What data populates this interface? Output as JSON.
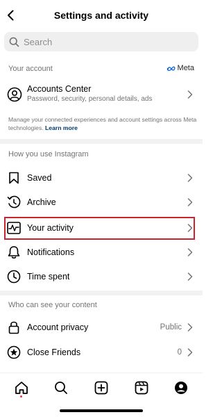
{
  "header": {
    "title": "Settings and activity"
  },
  "search": {
    "placeholder": "Search"
  },
  "sections": {
    "your_account": "Your account",
    "how_you_use": "How you use Instagram",
    "who_can_see": "Who can see your content"
  },
  "meta_logo": "Meta",
  "accounts_center": {
    "title": "Accounts Center",
    "subtitle": "Password, security, personal details, ads",
    "description": "Manage your connected experiences and account settings across Meta technologies.",
    "learn_more": "Learn more"
  },
  "how_you_use_items": [
    {
      "label": "Saved",
      "icon": "bookmark-icon"
    },
    {
      "label": "Archive",
      "icon": "archive-icon"
    },
    {
      "label": "Your activity",
      "icon": "activity-icon",
      "highlighted": true
    },
    {
      "label": "Notifications",
      "icon": "bell-icon"
    },
    {
      "label": "Time spent",
      "icon": "clock-icon"
    }
  ],
  "who_can_see_items": [
    {
      "label": "Account privacy",
      "value": "Public",
      "icon": "lock-icon"
    },
    {
      "label": "Close Friends",
      "value": "0",
      "icon": "star-icon"
    }
  ],
  "tabbar": [
    "home-icon",
    "search-icon",
    "create-icon",
    "reels-icon",
    "profile-icon"
  ],
  "colors": {
    "highlight": "#c8242f",
    "link": "#00376b",
    "notification_dot": "#ff3040"
  }
}
